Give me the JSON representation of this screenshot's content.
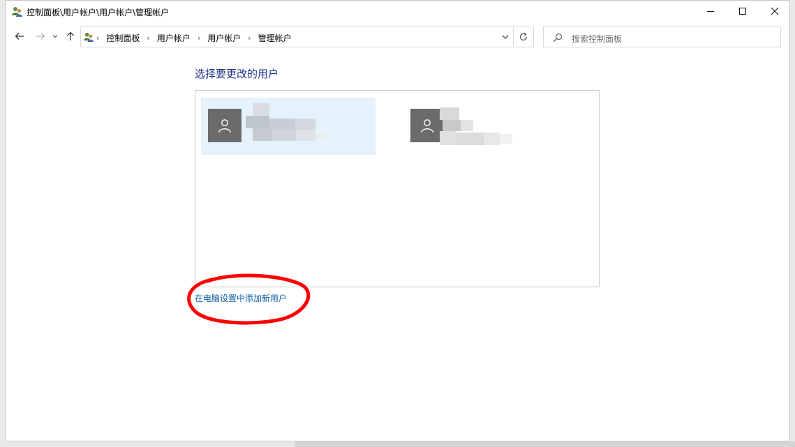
{
  "window": {
    "title": "控制面板\\用户帐户\\用户帐户\\管理帐户",
    "controls": [
      "minimize",
      "maximize",
      "close"
    ]
  },
  "nav": {
    "breadcrumbs": [
      "控制面板",
      "用户帐户",
      "用户帐户",
      "管理帐户"
    ],
    "search_placeholder": "搜索控制面板"
  },
  "main": {
    "heading": "选择要更改的用户",
    "users": [
      {
        "name": "",
        "selected": true
      },
      {
        "name": "",
        "selected": false
      }
    ],
    "add_user_link": "在电脑设置中添加新用户"
  },
  "colors": {
    "heading": "#1e3287",
    "link": "#0b5fa5",
    "selected_tile": "#e5f1fb",
    "avatar_bg": "#6b6b6b",
    "annotation_circle": "#ff0000"
  },
  "icons": [
    "users-app-icon",
    "back-arrow-icon",
    "forward-arrow-icon",
    "recent-dropdown-icon",
    "up-arrow-icon",
    "refresh-icon",
    "search-icon",
    "user-avatar-icon"
  ]
}
